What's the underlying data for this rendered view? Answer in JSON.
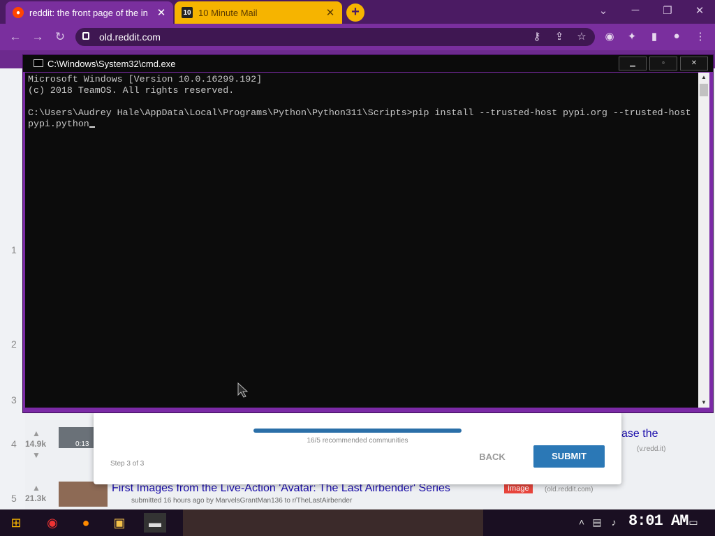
{
  "browser": {
    "tabs": [
      {
        "title": "reddit: the front page of the in",
        "active": true
      },
      {
        "title": "10 Minute Mail",
        "active": false
      }
    ],
    "url": "old.reddit.com"
  },
  "reddit": {
    "ranks": [
      "1",
      "2",
      "3",
      "4",
      "5"
    ],
    "post4_score": "14.9k",
    "post4_duration": "0:13",
    "post4_title_fragment": "ase the",
    "post4_domain": "(v.redd.it)",
    "post5_score": "21.3k",
    "post5_title": "First Images from the Live-Action 'Avatar: The Last Airbender' Series",
    "post5_flair": "Image",
    "post5_domain": "(old.reddit.com)",
    "post5_meta": "submitted 16 hours ago by MarvelsGrantMan136   to r/TheLastAirbender",
    "modal": {
      "progress_text": "16/5 recommended communities",
      "step_text": "Step 3 of 3",
      "back_label": "BACK",
      "submit_label": "SUBMIT",
      "progress_fraction": 1.0
    }
  },
  "cmd": {
    "title": "C:\\Windows\\System32\\cmd.exe",
    "lines": [
      "Microsoft Windows [Version 10.0.16299.192]",
      "(c) 2018 TeamOS. All rights reserved.",
      "",
      "C:\\Users\\Audrey Hale\\AppData\\Local\\Programs\\Python\\Python311\\Scripts>pip install --trusted-host pypi.org --trusted-host",
      "pypi.python"
    ]
  },
  "taskbar": {
    "clock": "8:01 AM"
  },
  "colors": {
    "chrome_dark": "#4b1b63",
    "chrome_mid": "#7a2f9e",
    "tab2": "#f6b400",
    "submit": "#2b78b6"
  }
}
